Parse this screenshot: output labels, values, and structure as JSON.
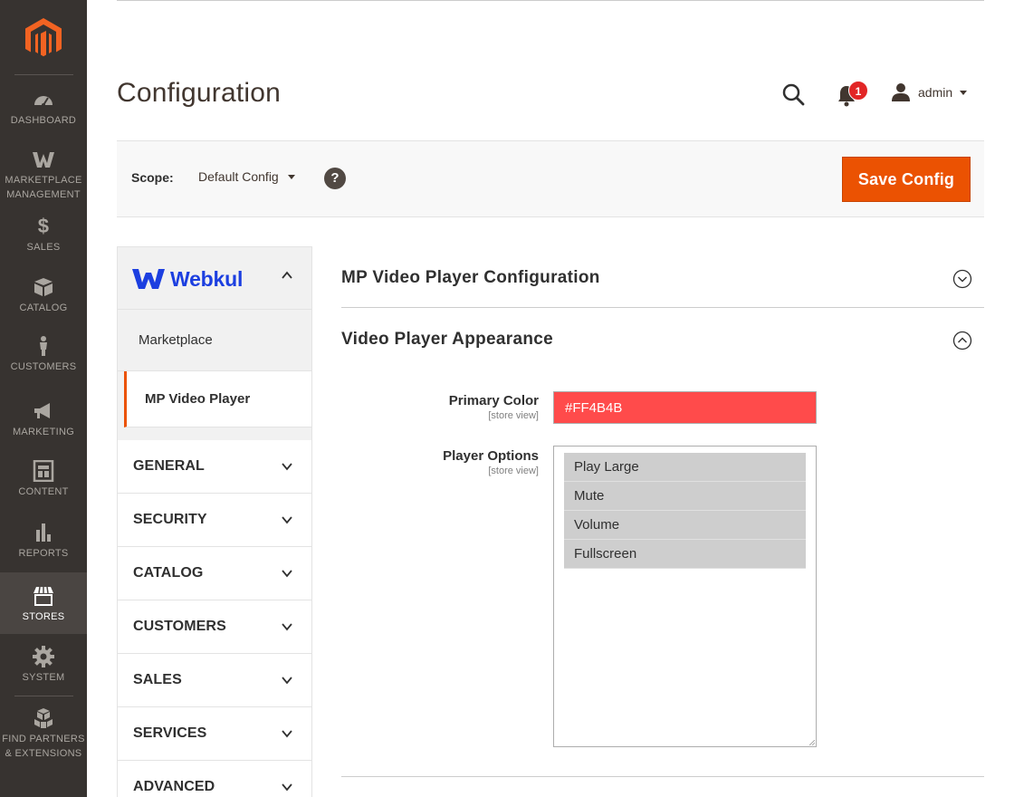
{
  "nav": {
    "items": [
      {
        "label": "DASHBOARD",
        "icon": "dashboard-icon"
      },
      {
        "label": "MARKETPLACE MANAGEMENT",
        "icon": "webkul-w-icon"
      },
      {
        "label": "SALES",
        "icon": "dollar-icon"
      },
      {
        "label": "CATALOG",
        "icon": "box-icon"
      },
      {
        "label": "CUSTOMERS",
        "icon": "person-icon"
      },
      {
        "label": "MARKETING",
        "icon": "megaphone-icon"
      },
      {
        "label": "CONTENT",
        "icon": "layout-icon"
      },
      {
        "label": "REPORTS",
        "icon": "bar-chart-icon"
      },
      {
        "label": "STORES",
        "icon": "store-icon",
        "active": true
      },
      {
        "label": "SYSTEM",
        "icon": "gear-icon"
      },
      {
        "label": "FIND PARTNERS & EXTENSIONS",
        "icon": "cubes-icon"
      }
    ]
  },
  "header": {
    "title": "Configuration",
    "notifications_count": "1",
    "user_name": "admin"
  },
  "scope": {
    "label": "Scope:",
    "value": "Default Config",
    "help": "?",
    "save_label": "Save Config"
  },
  "sidebar": {
    "brand": "Webkul",
    "sub_items": [
      "Marketplace",
      "MP Video Player"
    ],
    "sections": [
      "GENERAL",
      "SECURITY",
      "CATALOG",
      "CUSTOMERS",
      "SALES",
      "SERVICES",
      "ADVANCED"
    ]
  },
  "main": {
    "group_1_title": "MP Video Player Configuration",
    "group_2_title": "Video Player Appearance",
    "primary_color": {
      "label": "Primary Color",
      "scope": "[store view]",
      "value": "#FF4B4B"
    },
    "player_options": {
      "label": "Player Options",
      "scope": "[store view]",
      "options": [
        "Play Large",
        "Mute",
        "Volume",
        "Fullscreen"
      ]
    }
  },
  "colors": {
    "nav_bg": "#373330",
    "accent": "#eb5202",
    "primary_color_swatch": "#ff4b4b",
    "brand_blue": "#1c3fe0"
  }
}
